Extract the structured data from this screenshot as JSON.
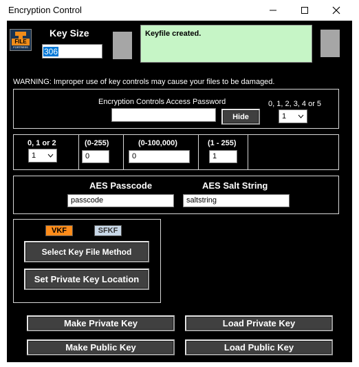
{
  "window": {
    "title": "Encryption Control",
    "minimize_icon": "minimize-icon",
    "maximize_icon": "maximize-icon",
    "close_icon": "close-icon"
  },
  "logo": {
    "icon": "file-fortress-logo",
    "text_line1": "FILE",
    "text_line2": "FORTRESS"
  },
  "key_size": {
    "label": "Key Size",
    "value": "306"
  },
  "status": {
    "message": "Keyfile created.",
    "color": "#c6f5c6"
  },
  "warning": "WARNING: Improper use of key controls may cause your files to be damaged.",
  "access": {
    "label": "Encryption Controls Access Password",
    "password_value": "",
    "hide_label": "Hide",
    "level_label": "0, 1, 2, 3, 4 or 5",
    "level_value": "1"
  },
  "params": [
    {
      "label": "0, 1 or 2",
      "value": "1",
      "kind": "select"
    },
    {
      "label": "(0-255)",
      "value": "0",
      "kind": "input"
    },
    {
      "label": "(0-100,000)",
      "value": "0",
      "kind": "input"
    },
    {
      "label": "(1 - 255)",
      "value": "1",
      "kind": "input"
    }
  ],
  "aes": {
    "passcode_label": "AES Passcode",
    "passcode_value": "passcode",
    "salt_label": "AES Salt String",
    "salt_value": "saltstring"
  },
  "keyfile": {
    "vkf_label": "VKF",
    "vkf_color": "#ff8c1a",
    "sfkf_label": "SFKF",
    "sfkf_color": "#c8d8e8",
    "select_method_label": "Select Key File Method",
    "set_location_label": "Set Private Key Location"
  },
  "actions": {
    "make_private": "Make Private Key",
    "load_private": "Load Private Key",
    "make_public": "Make Public Key",
    "load_public": "Load Public Key"
  }
}
